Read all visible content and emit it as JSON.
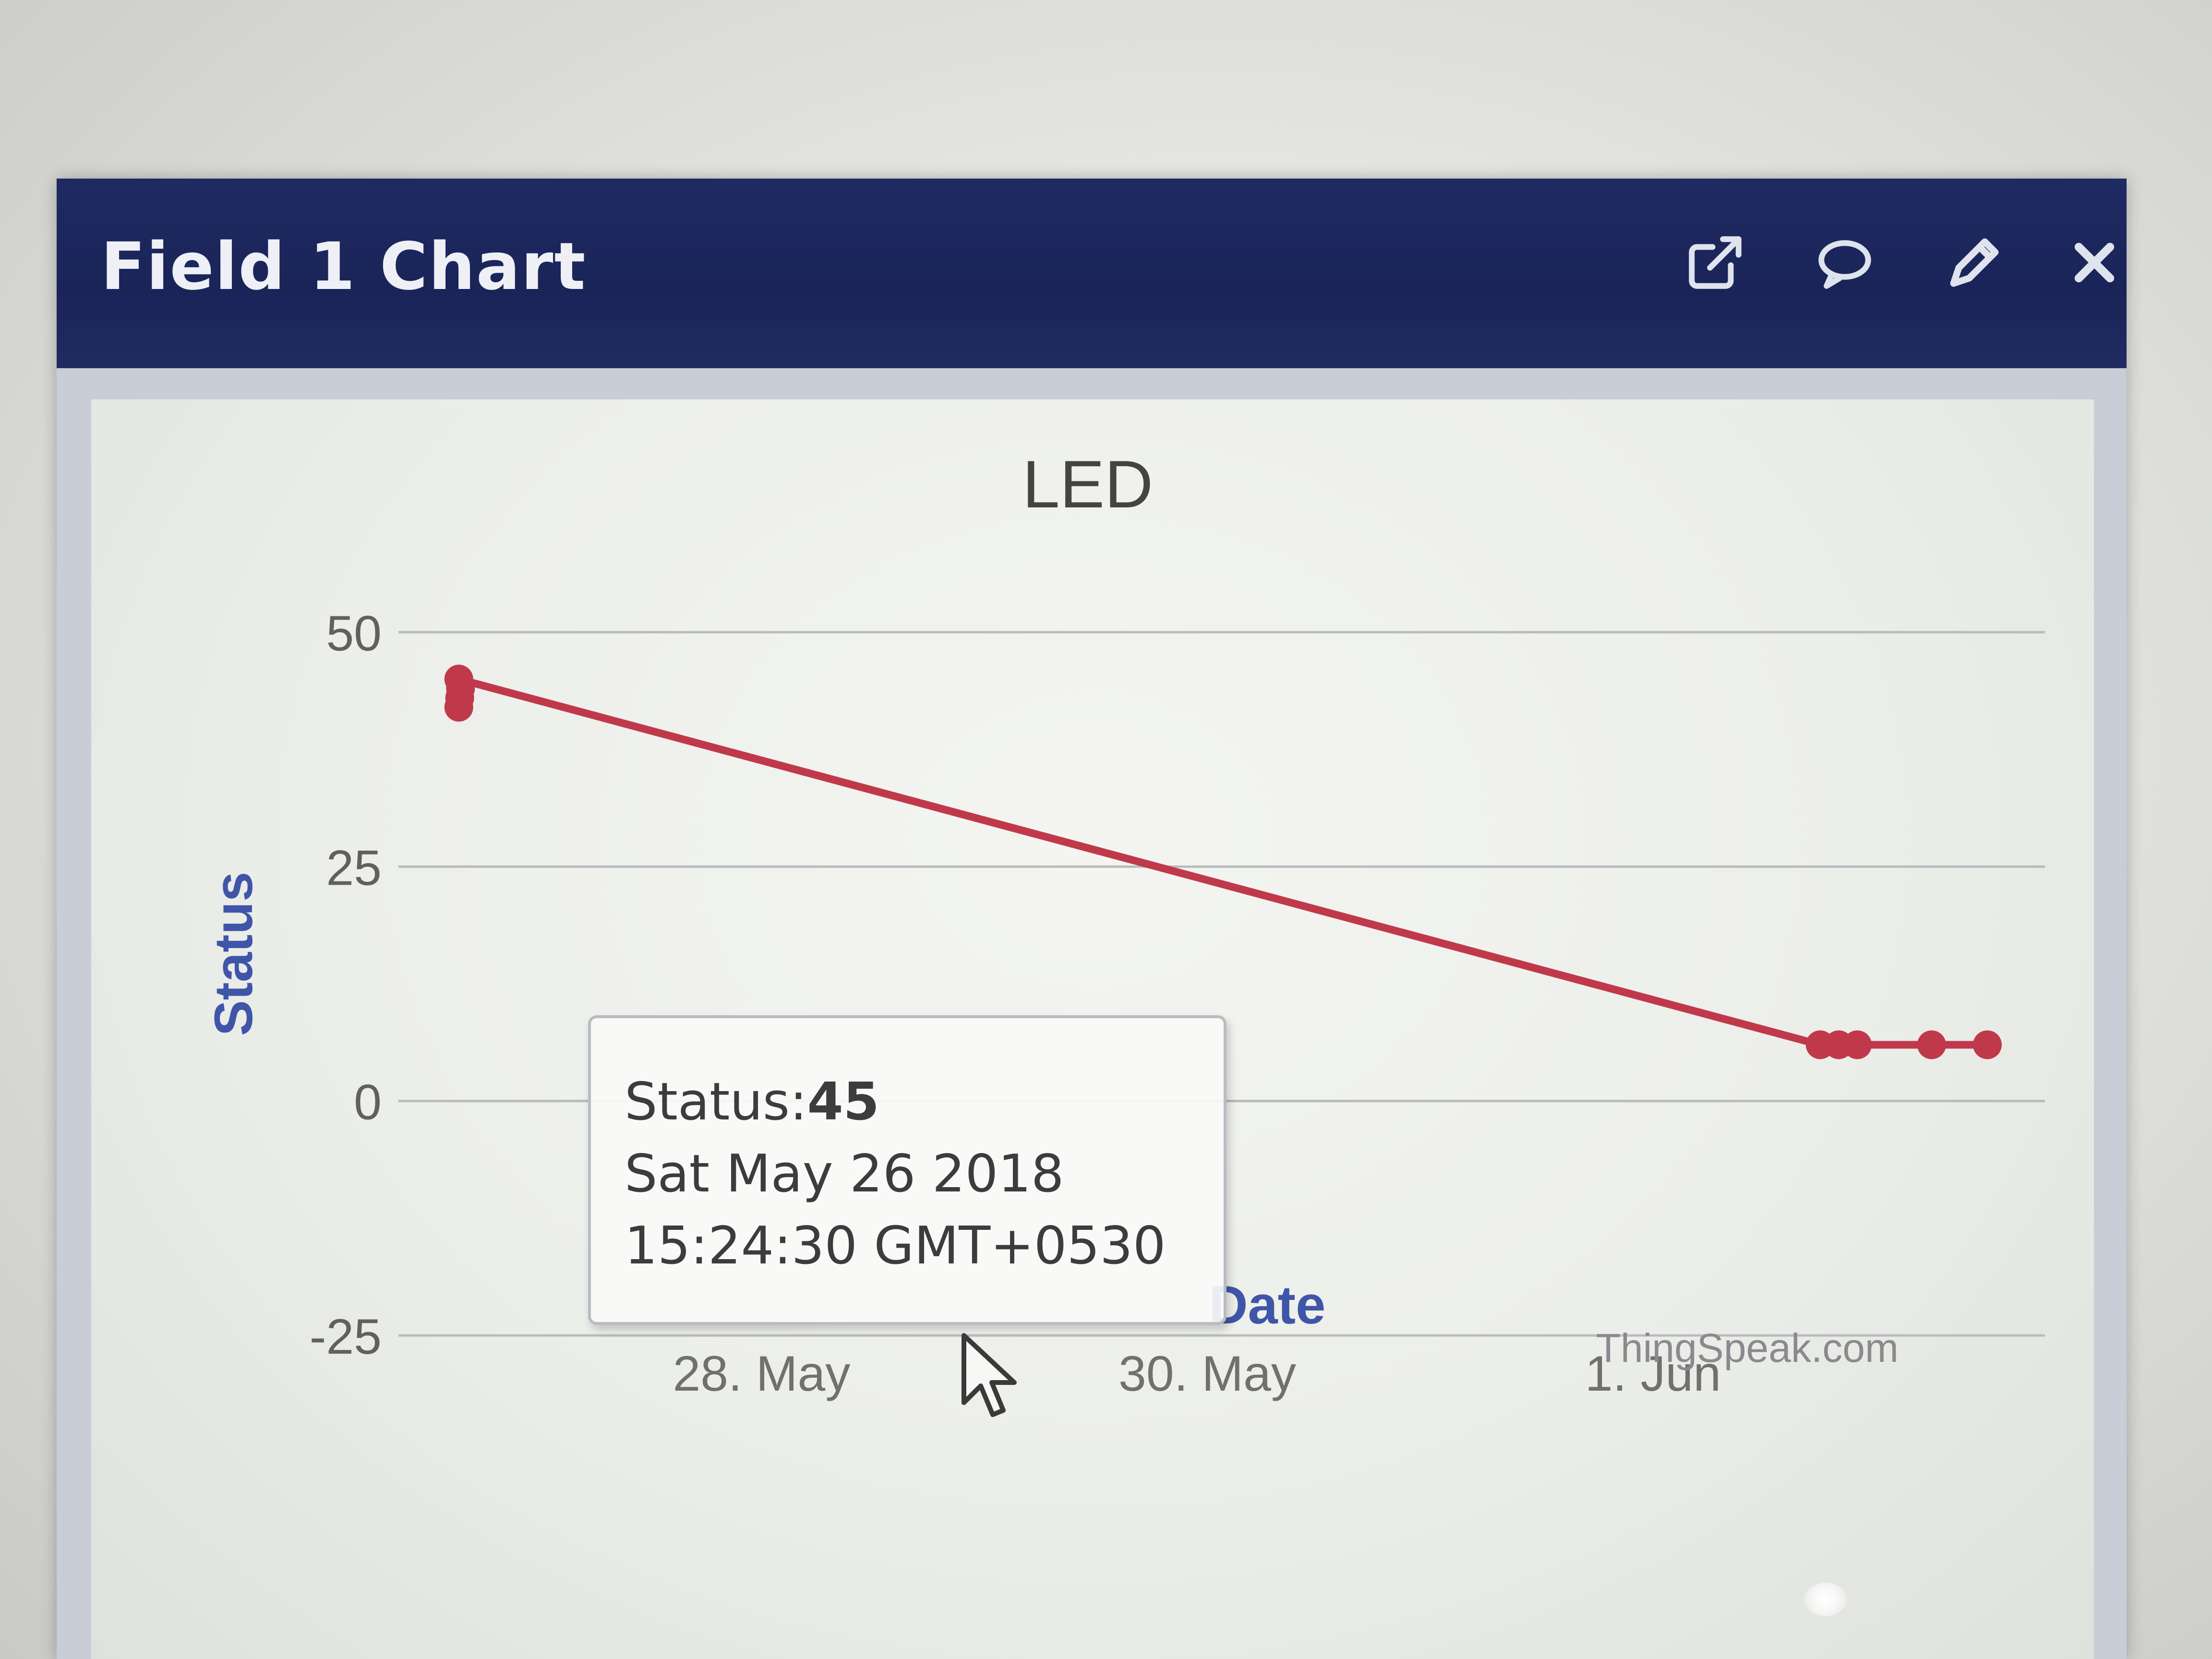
{
  "window": {
    "title": "Field 1 Chart",
    "actions": [
      {
        "icon": "external-link-icon"
      },
      {
        "icon": "comment-icon"
      },
      {
        "icon": "pencil-icon"
      },
      {
        "icon": "close-icon"
      }
    ]
  },
  "colors": {
    "titlebar": "#1e2a63",
    "series": "#c0394b",
    "axis_title": "#3f55a8",
    "grid": "#b9bbbf"
  },
  "tooltip": {
    "label": "Status:",
    "value": "45",
    "date": "Sat May 26 2018",
    "time": "15:24:30 GMT+0530"
  },
  "credit": "ThingSpeak.com",
  "chart_data": {
    "type": "line",
    "title": "LED",
    "xlabel": "Date",
    "ylabel": "Status",
    "ylim": [
      -25,
      50
    ],
    "yticks": [
      {
        "value": 50,
        "label": "50"
      },
      {
        "value": 25,
        "label": "25"
      },
      {
        "value": 0,
        "label": "0"
      },
      {
        "value": -25,
        "label": "-25"
      }
    ],
    "xlim": [
      "2018-05-26T12:00",
      "2018-06-02T12:00"
    ],
    "xticks": [
      {
        "value": "2018-05-28T00:00",
        "label": "28. May"
      },
      {
        "value": "2018-05-30T00:00",
        "label": "30. May"
      },
      {
        "value": "2018-06-01T00:00",
        "label": "1. Jun"
      }
    ],
    "grid": true,
    "legend": "none",
    "series": [
      {
        "color": "#c0394b",
        "points": [
          {
            "x": "2018-05-26T15:24",
            "y": 42
          },
          {
            "x": "2018-05-26T15:30",
            "y": 43
          },
          {
            "x": "2018-05-26T15:35",
            "y": 44
          },
          {
            "x": "2018-05-26T15:24",
            "y": 45
          },
          {
            "x": "2018-06-01T18:00",
            "y": 6
          },
          {
            "x": "2018-06-01T20:00",
            "y": 6
          },
          {
            "x": "2018-06-01T22:00",
            "y": 6
          },
          {
            "x": "2018-06-02T06:00",
            "y": 6
          },
          {
            "x": "2018-06-02T12:00",
            "y": 6
          }
        ]
      }
    ]
  }
}
